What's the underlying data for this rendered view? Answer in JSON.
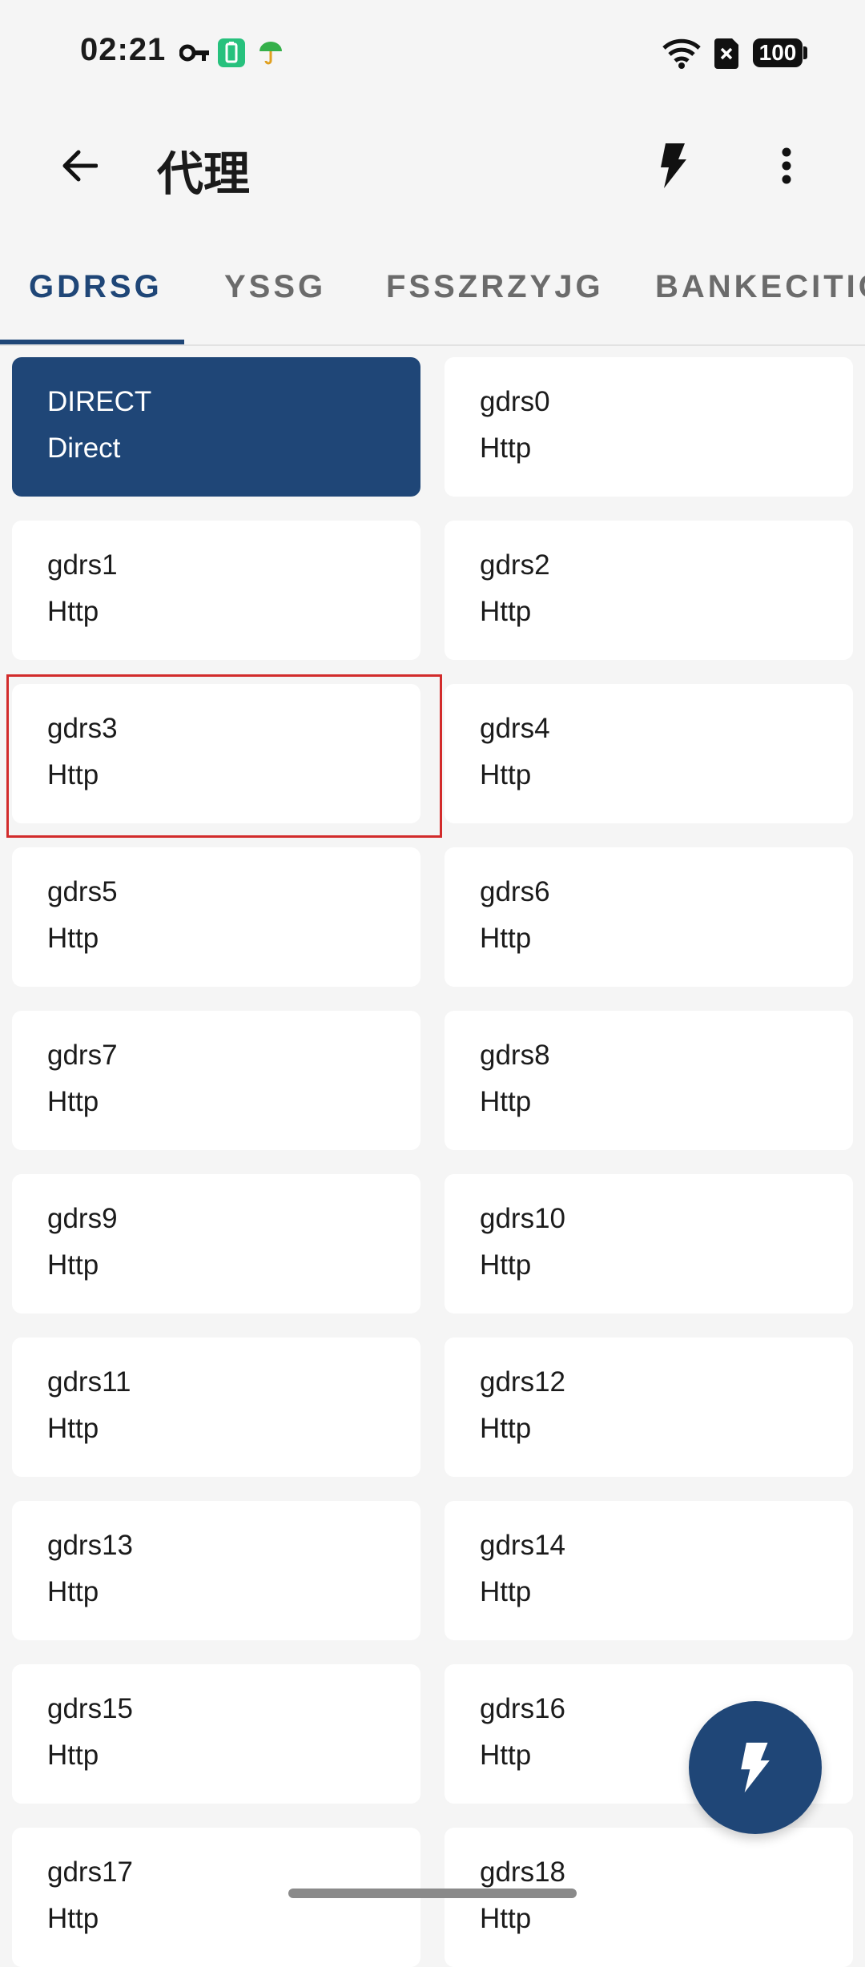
{
  "status_bar": {
    "time": "02:21",
    "battery": "100"
  },
  "app_bar": {
    "title": "代理",
    "back_icon": "arrow-left-icon",
    "flash_icon": "lightning-icon",
    "more_icon": "more-vert-icon"
  },
  "tabs": [
    {
      "label": "GDRSG",
      "active": true
    },
    {
      "label": "YSSG",
      "active": false
    },
    {
      "label": "FSSZRZYJG",
      "active": false
    },
    {
      "label": "BANKECITIC",
      "active": false
    }
  ],
  "proxies": [
    {
      "name": "DIRECT",
      "type": "Direct",
      "selected": true
    },
    {
      "name": "gdrs0",
      "type": "Http"
    },
    {
      "name": "gdrs1",
      "type": "Http"
    },
    {
      "name": "gdrs2",
      "type": "Http"
    },
    {
      "name": "gdrs3",
      "type": "Http"
    },
    {
      "name": "gdrs4",
      "type": "Http"
    },
    {
      "name": "gdrs5",
      "type": "Http"
    },
    {
      "name": "gdrs6",
      "type": "Http"
    },
    {
      "name": "gdrs7",
      "type": "Http"
    },
    {
      "name": "gdrs8",
      "type": "Http"
    },
    {
      "name": "gdrs9",
      "type": "Http"
    },
    {
      "name": "gdrs10",
      "type": "Http"
    },
    {
      "name": "gdrs11",
      "type": "Http"
    },
    {
      "name": "gdrs12",
      "type": "Http"
    },
    {
      "name": "gdrs13",
      "type": "Http"
    },
    {
      "name": "gdrs14",
      "type": "Http"
    },
    {
      "name": "gdrs15",
      "type": "Http"
    },
    {
      "name": "gdrs16",
      "type": "Http"
    },
    {
      "name": "gdrs17",
      "type": "Http"
    },
    {
      "name": "gdrs18",
      "type": "Http"
    }
  ],
  "colors": {
    "accent": "#1f4677",
    "highlight": "#d22b2b"
  }
}
